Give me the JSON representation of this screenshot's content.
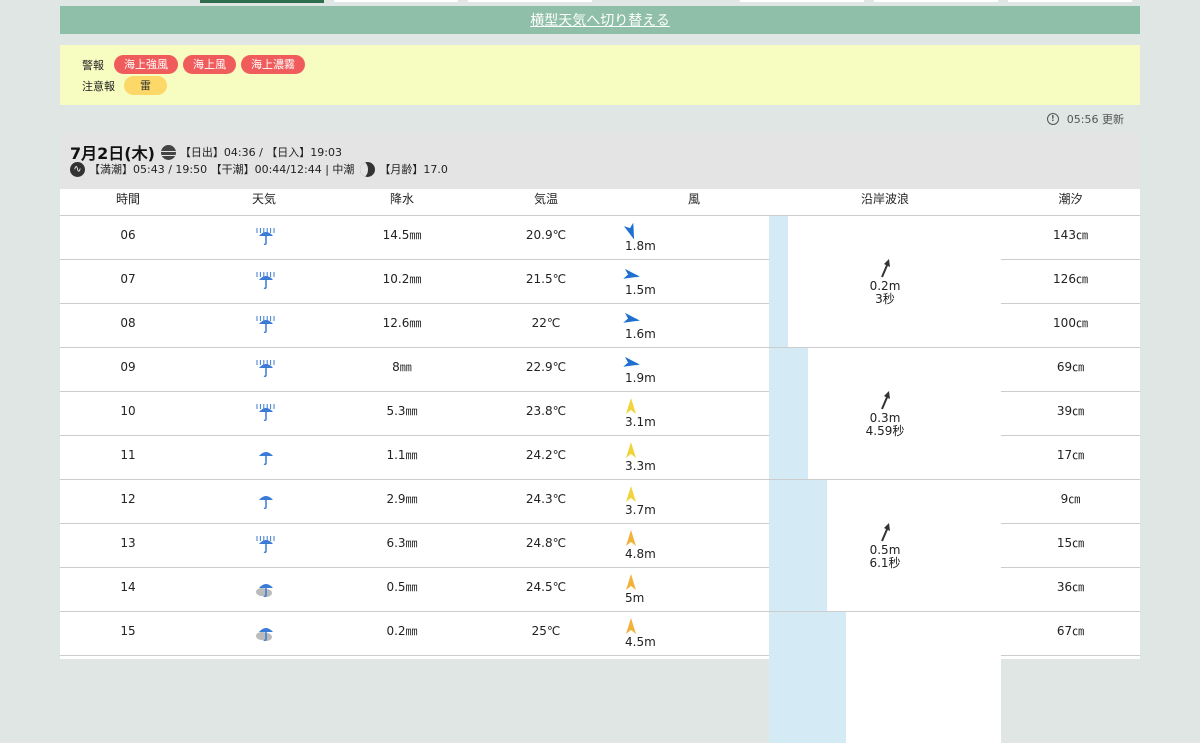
{
  "switch_link": "横型天気へ切り替える",
  "alerts": {
    "warning_label": "警報",
    "warnings": [
      "海上強風",
      "海上風",
      "海上濃霧"
    ],
    "advisory_label": "注意報",
    "advisories": [
      "雷"
    ]
  },
  "updated": "05:56 更新",
  "day": {
    "date": "7月2日(木)",
    "sun": "【日出】04:36 / 【日入】19:03",
    "tide": "【満潮】05:43 / 19:50 【干潮】00:44/12:44 | 中潮",
    "moon_age": "【月齢】17.0"
  },
  "columns": [
    "時間",
    "天気",
    "降水",
    "気温",
    "風",
    "沿岸波浪",
    "潮汐"
  ],
  "rows": [
    {
      "hour": "06",
      "weather_icon": "heavy-rain-icon",
      "precip": "14.5㎜",
      "temp": "20.9℃",
      "wind_speed": "1.8m",
      "wind_color": "#1f6fd0",
      "wind_angle": 160,
      "tide": "143㎝"
    },
    {
      "hour": "07",
      "weather_icon": "heavy-rain-icon",
      "precip": "10.2㎜",
      "temp": "21.5℃",
      "wind_speed": "1.5m",
      "wind_color": "#1f6fd0",
      "wind_angle": 100,
      "tide": "126㎝"
    },
    {
      "hour": "08",
      "weather_icon": "heavy-rain-icon",
      "precip": "12.6㎜",
      "temp": "22℃",
      "wind_speed": "1.6m",
      "wind_color": "#1f6fd0",
      "wind_angle": 100,
      "tide": "100㎝"
    },
    {
      "hour": "09",
      "weather_icon": "heavy-rain-icon",
      "precip": "8㎜",
      "temp": "22.9℃",
      "wind_speed": "1.9m",
      "wind_color": "#1f6fd0",
      "wind_angle": 100,
      "tide": "69㎝"
    },
    {
      "hour": "10",
      "weather_icon": "rain-icon",
      "precip": "5.3㎜",
      "temp": "23.8℃",
      "wind_speed": "3.1m",
      "wind_color": "#f2d43a",
      "wind_angle": 0,
      "tide": "39㎝"
    },
    {
      "hour": "11",
      "weather_icon": "umbrella-icon",
      "precip": "1.1㎜",
      "temp": "24.2℃",
      "wind_speed": "3.3m",
      "wind_color": "#f2d43a",
      "wind_angle": 0,
      "tide": "17㎝"
    },
    {
      "hour": "12",
      "weather_icon": "umbrella-icon",
      "precip": "2.9㎜",
      "temp": "24.3℃",
      "wind_speed": "3.7m",
      "wind_color": "#f2d43a",
      "wind_angle": 0,
      "tide": "9㎝"
    },
    {
      "hour": "13",
      "weather_icon": "rain-icon",
      "precip": "6.3㎜",
      "temp": "24.8℃",
      "wind_speed": "4.8m",
      "wind_color": "#f1b33c",
      "wind_angle": 0,
      "tide": "15㎝"
    },
    {
      "hour": "14",
      "weather_icon": "cloud-rain-icon",
      "precip": "0.5㎜",
      "temp": "24.5℃",
      "wind_speed": "5m",
      "wind_color": "#f1b33c",
      "wind_angle": 0,
      "tide": "36㎝"
    },
    {
      "hour": "15",
      "weather_icon": "cloud-rain-icon",
      "precip": "0.2㎜",
      "temp": "25℃",
      "wind_speed": "4.5m",
      "wind_color": "#f1b33c",
      "wind_angle": 0,
      "tide": "67㎝"
    }
  ],
  "waves": [
    {
      "height": "0.2m",
      "period": "3秒",
      "level": 0.08
    },
    {
      "height": "0.3m",
      "period": "4.59秒",
      "level": 0.17
    },
    {
      "height": "0.5m",
      "period": "6.1秒",
      "level": 0.25
    },
    {
      "height": "",
      "period": "",
      "level": 0.33
    }
  ]
}
